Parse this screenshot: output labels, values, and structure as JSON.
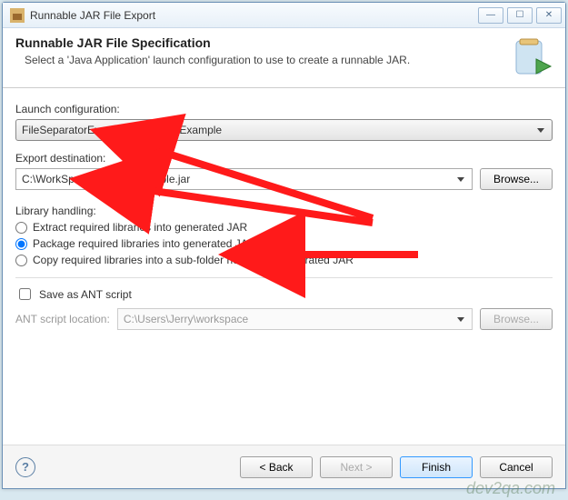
{
  "window": {
    "title": "Runnable JAR File Export"
  },
  "banner": {
    "heading": "Runnable JAR File Specification",
    "subtext": "Select a 'Java Application' launch configuration to use to create a runnable JAR."
  },
  "launch": {
    "label": "Launch configuration:",
    "value": "FileSeparatorExample - Dev2QaExample"
  },
  "export": {
    "label": "Export destination:",
    "value": "C:\\WorkSpace\\Dev2qaExample.jar",
    "browse": "Browse..."
  },
  "library": {
    "label": "Library handling:",
    "options": [
      "Extract required libraries into generated JAR",
      "Package required libraries into generated JAR",
      "Copy required libraries into a sub-folder next to the generated JAR"
    ],
    "selected": 1
  },
  "ant": {
    "check_label": "Save as ANT script",
    "loc_label": "ANT script location:",
    "loc_value": "C:\\Users\\Jerry\\workspace",
    "browse": "Browse..."
  },
  "footer": {
    "back": "< Back",
    "next": "Next >",
    "finish": "Finish",
    "cancel": "Cancel"
  },
  "watermark": "dev2qa.com"
}
